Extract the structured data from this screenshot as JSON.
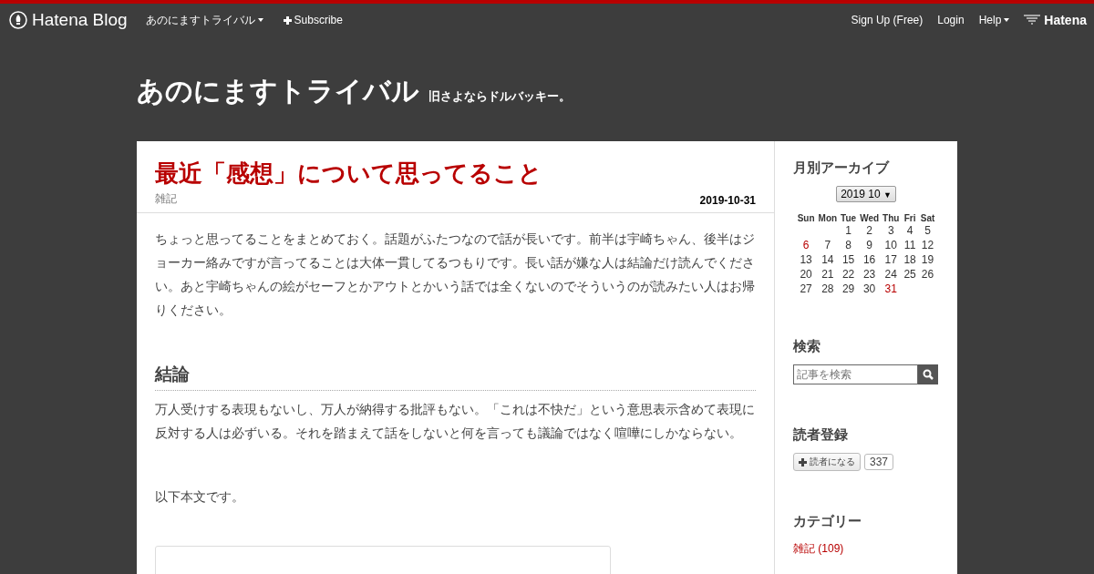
{
  "topbar": {
    "logo": "Hatena Blog",
    "blog_menu": "あのにますトライバル",
    "subscribe": "Subscribe",
    "links": [
      {
        "label": "Sign Up (Free)",
        "kind": "link"
      },
      {
        "label": "Login",
        "kind": "link"
      },
      {
        "label": "Help",
        "kind": "dropdown"
      }
    ],
    "brand": "Hatena"
  },
  "header": {
    "title": "あのにますトライバル",
    "tagline": "旧さよならドルバッキー。"
  },
  "article": {
    "title": "最近「感想」について思ってること",
    "category": "雑記",
    "date": "2019-10-31",
    "blocks": [
      {
        "kind": "paragraph",
        "text": "ちょっと思ってることをまとめておく。話題がふたつなので話が長いです。前半は宇崎ちゃん、後半はジョーカー絡みですが言ってることは大体一貫してるつもりです。長い話が嫌な人は結論だけ読んでください。あと宇崎ちゃんの絵がセーフとかアウトとかいう話では全くないのでそういうのが読みたい人はお帰りください。"
      },
      {
        "kind": "heading",
        "text": "結論"
      },
      {
        "kind": "paragraph",
        "text": "万人受けする表現もないし、万人が納得する批評もない。「これは不快だ」という意思表示含めて表現に反対する人は必ずいる。それを踏まえて話をしないと何を言っても議論ではなく喧嘩にしかならない。"
      },
      {
        "kind": "paragraph",
        "text": "以下本文です。"
      },
      {
        "kind": "embed"
      }
    ]
  },
  "sidebar": {
    "archive": {
      "title": "月別アーカイブ",
      "month": "2019 10",
      "month_arrow": "▼",
      "weekdays": [
        "Sun",
        "Mon",
        "Tue",
        "Wed",
        "Thu",
        "Fri",
        "Sat"
      ],
      "weeks": [
        [
          {
            "kind": "blank"
          },
          {
            "kind": "blank"
          },
          {
            "kind": "day",
            "day": "1",
            "highlighted": false
          },
          {
            "kind": "day",
            "day": "2",
            "highlighted": false
          },
          {
            "kind": "day",
            "day": "3",
            "highlighted": false
          },
          {
            "kind": "day",
            "day": "4",
            "highlighted": false
          },
          {
            "kind": "day",
            "day": "5",
            "highlighted": false
          }
        ],
        [
          {
            "kind": "day",
            "day": "6",
            "highlighted": true
          },
          {
            "kind": "day",
            "day": "7",
            "highlighted": false
          },
          {
            "kind": "day",
            "day": "8",
            "highlighted": false
          },
          {
            "kind": "day",
            "day": "9",
            "highlighted": false
          },
          {
            "kind": "day",
            "day": "10",
            "highlighted": false
          },
          {
            "kind": "day",
            "day": "11",
            "highlighted": false
          },
          {
            "kind": "day",
            "day": "12",
            "highlighted": false
          }
        ],
        [
          {
            "kind": "day",
            "day": "13",
            "highlighted": false
          },
          {
            "kind": "day",
            "day": "14",
            "highlighted": false
          },
          {
            "kind": "day",
            "day": "15",
            "highlighted": false
          },
          {
            "kind": "day",
            "day": "16",
            "highlighted": false
          },
          {
            "kind": "day",
            "day": "17",
            "highlighted": false
          },
          {
            "kind": "day",
            "day": "18",
            "highlighted": false
          },
          {
            "kind": "day",
            "day": "19",
            "highlighted": false
          }
        ],
        [
          {
            "kind": "day",
            "day": "20",
            "highlighted": false
          },
          {
            "kind": "day",
            "day": "21",
            "highlighted": false
          },
          {
            "kind": "day",
            "day": "22",
            "highlighted": false
          },
          {
            "kind": "day",
            "day": "23",
            "highlighted": false
          },
          {
            "kind": "day",
            "day": "24",
            "highlighted": false
          },
          {
            "kind": "day",
            "day": "25",
            "highlighted": false
          },
          {
            "kind": "day",
            "day": "26",
            "highlighted": false
          }
        ],
        [
          {
            "kind": "day",
            "day": "27",
            "highlighted": false
          },
          {
            "kind": "day",
            "day": "28",
            "highlighted": false
          },
          {
            "kind": "day",
            "day": "29",
            "highlighted": false
          },
          {
            "kind": "day",
            "day": "30",
            "highlighted": false
          },
          {
            "kind": "day",
            "day": "31",
            "highlighted": true
          },
          {
            "kind": "blank"
          },
          {
            "kind": "blank"
          }
        ]
      ]
    },
    "search": {
      "title": "検索",
      "placeholder": "記事を検索"
    },
    "readers": {
      "title": "読者登録",
      "button": "読者になる",
      "count": "337"
    },
    "categories": {
      "title": "カテゴリー",
      "items": [
        "雑記 (109)"
      ]
    }
  }
}
